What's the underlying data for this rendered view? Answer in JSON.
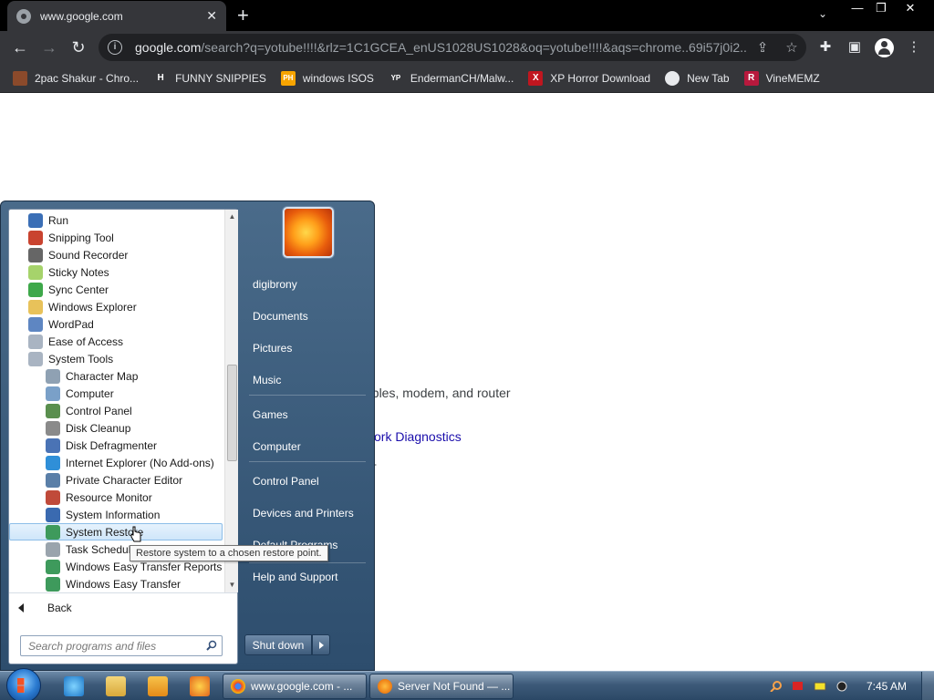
{
  "browser": {
    "tab_title": "www.google.com",
    "url_host": "google.com",
    "url_path": "/search?q=yotube!!!!&rlz=1C1GCEA_enUS1028US1028&oq=yotube!!!!&aqs=chrome..69i57j0i2...",
    "bookmarks": [
      {
        "label": "2pac Shakur - Chro...",
        "icon": "2pac-bookmark-icon",
        "color": "#8b4a2b",
        "glyph": ""
      },
      {
        "label": "FUNNY SNIPPIES",
        "icon": "h-bookmark-icon",
        "color": "#35363a",
        "glyph": "H"
      },
      {
        "label": "windows ISOS",
        "icon": "ph-bookmark-icon",
        "color": "#f7a400",
        "glyph": "PH"
      },
      {
        "label": "EndermanCH/Malw...",
        "icon": "yp-bookmark-icon",
        "color": "#35363a",
        "glyph": "YP"
      },
      {
        "label": "XP Horror Download",
        "icon": "x-bookmark-icon",
        "color": "#c0161f",
        "glyph": "X"
      },
      {
        "label": "New Tab",
        "icon": "globe-bookmark-icon",
        "color": "#e8eaed",
        "glyph": ""
      },
      {
        "label": "VineMEMZ",
        "icon": "r-bookmark-icon",
        "color": "#b8193d",
        "glyph": "R"
      }
    ]
  },
  "page": {
    "text_fragment": "ables, modem, and router",
    "link_fragment": "ork Diagnostics",
    "dash": "-"
  },
  "start_menu": {
    "programs": [
      {
        "label": "Run",
        "icon": "run-icon",
        "indent": 0,
        "color": "#3b6fb6"
      },
      {
        "label": "Snipping Tool",
        "icon": "snipping-tool-icon",
        "indent": 0,
        "color": "#c9432f"
      },
      {
        "label": "Sound Recorder",
        "icon": "microphone-icon",
        "indent": 0,
        "color": "#666"
      },
      {
        "label": "Sticky Notes",
        "icon": "sticky-notes-icon",
        "indent": 0,
        "color": "#a6d36b"
      },
      {
        "label": "Sync Center",
        "icon": "sync-icon",
        "indent": 0,
        "color": "#3ea84a"
      },
      {
        "label": "Windows Explorer",
        "icon": "folder-icon",
        "indent": 0,
        "color": "#e8c25a"
      },
      {
        "label": "WordPad",
        "icon": "wordpad-icon",
        "indent": 0,
        "color": "#5e86c2"
      },
      {
        "label": "Ease of Access",
        "icon": "folder-icon",
        "indent": 0,
        "color": "#a9b4c2"
      },
      {
        "label": "System Tools",
        "icon": "folder-icon",
        "indent": 0,
        "color": "#a9b4c2"
      },
      {
        "label": "Character Map",
        "icon": "character-map-icon",
        "indent": 1,
        "color": "#8fa1b3"
      },
      {
        "label": "Computer",
        "icon": "computer-icon",
        "indent": 1,
        "color": "#7aa0c8"
      },
      {
        "label": "Control Panel",
        "icon": "control-panel-icon",
        "indent": 1,
        "color": "#5a8f4e"
      },
      {
        "label": "Disk Cleanup",
        "icon": "disk-cleanup-icon",
        "indent": 1,
        "color": "#8a8a8a"
      },
      {
        "label": "Disk Defragmenter",
        "icon": "defragmenter-icon",
        "indent": 1,
        "color": "#4a73b5"
      },
      {
        "label": "Internet Explorer (No Add-ons)",
        "icon": "internet-explorer-icon",
        "indent": 1,
        "color": "#2f8fd8"
      },
      {
        "label": "Private Character Editor",
        "icon": "character-editor-icon",
        "indent": 1,
        "color": "#5a7fa8"
      },
      {
        "label": "Resource Monitor",
        "icon": "resource-monitor-icon",
        "indent": 1,
        "color": "#c04a3a"
      },
      {
        "label": "System Information",
        "icon": "system-information-icon",
        "indent": 1,
        "color": "#3a6ab0"
      },
      {
        "label": "System Restore",
        "icon": "system-restore-icon",
        "indent": 1,
        "color": "#3e9a5c",
        "selected": true
      },
      {
        "label": "Task Scheduler",
        "icon": "task-scheduler-icon",
        "indent": 1,
        "color": "#9aa4ad"
      },
      {
        "label": "Windows Easy Transfer Reports",
        "icon": "easy-transfer-icon",
        "indent": 1,
        "color": "#3e9a5c"
      },
      {
        "label": "Windows Easy Transfer",
        "icon": "easy-transfer-icon",
        "indent": 1,
        "color": "#3e9a5c"
      }
    ],
    "back_label": "Back",
    "search_placeholder": "Search programs and files",
    "right_items": [
      {
        "label": "digibrony",
        "icon": "user-name"
      },
      {
        "label": "Documents",
        "icon": "documents"
      },
      {
        "label": "Pictures",
        "icon": "pictures"
      },
      {
        "label": "Music",
        "icon": "music"
      },
      {
        "label": "Games",
        "icon": "games"
      },
      {
        "label": "Computer",
        "icon": "computer"
      },
      {
        "label": "Control Panel",
        "icon": "control-panel"
      },
      {
        "label": "Devices and Printers",
        "icon": "devices-and-printers"
      },
      {
        "label": "Default Programs",
        "icon": "default-programs"
      },
      {
        "label": "Help and Support",
        "icon": "help-and-support"
      }
    ],
    "shutdown_label": "Shut down",
    "tooltip": "Restore system to a chosen restore point."
  },
  "taskbar": {
    "tasks": [
      {
        "label": "www.google.com - ...",
        "icon": "chrome-icon"
      },
      {
        "label": "Server Not Found — ...",
        "icon": "firefox-icon"
      }
    ],
    "clock": "7:45 AM"
  }
}
